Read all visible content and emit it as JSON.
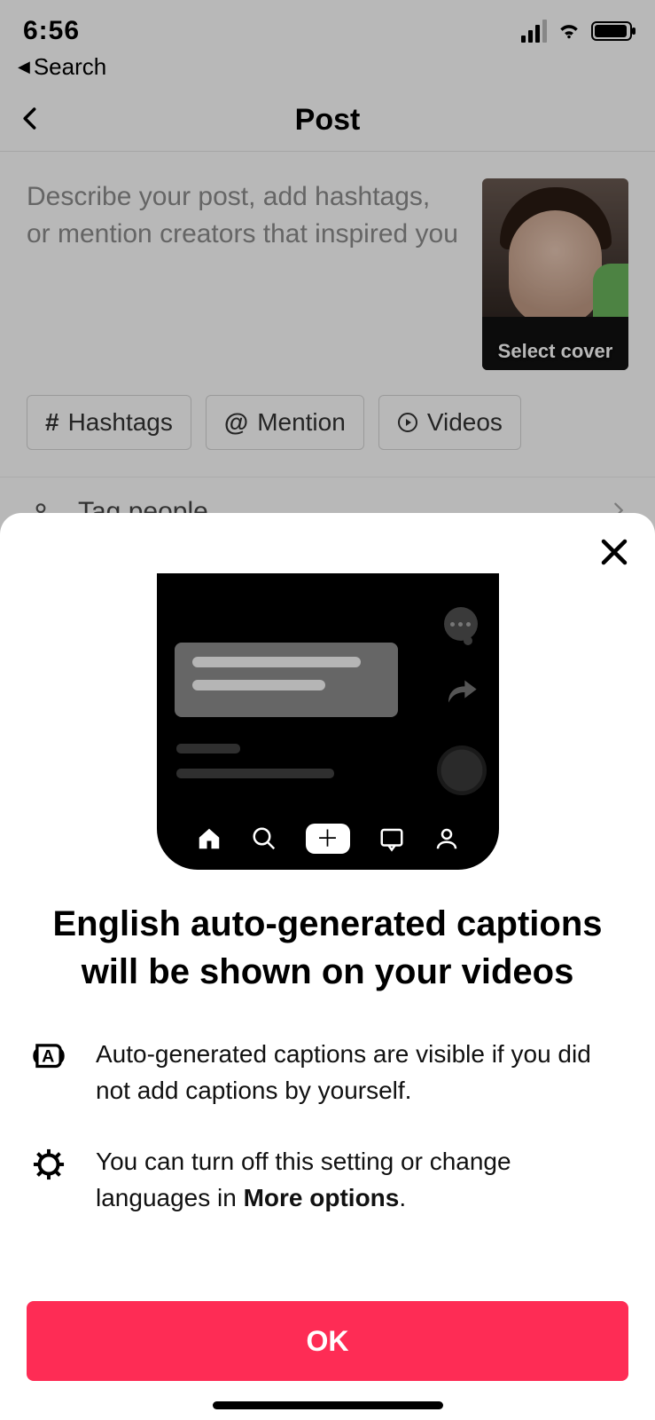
{
  "status": {
    "time": "6:56"
  },
  "breadcrumb": {
    "back_label": "Search"
  },
  "nav": {
    "title": "Post"
  },
  "compose": {
    "placeholder": "Describe your post, add hashtags, or mention creators that inspired you",
    "cover_button": "Select cover"
  },
  "chips": {
    "hashtags": "Hashtags",
    "mention": "Mention",
    "videos": "Videos"
  },
  "rows": {
    "tag_people": "Tag people"
  },
  "sheet": {
    "title": "English auto-generated captions will be shown on your videos",
    "info1": "Auto-generated captions are visible if you did not add captions by yourself.",
    "info2_pre": "You can turn off this setting or change languages in ",
    "info2_bold": "More options",
    "info2_post": ".",
    "ok": "OK"
  }
}
